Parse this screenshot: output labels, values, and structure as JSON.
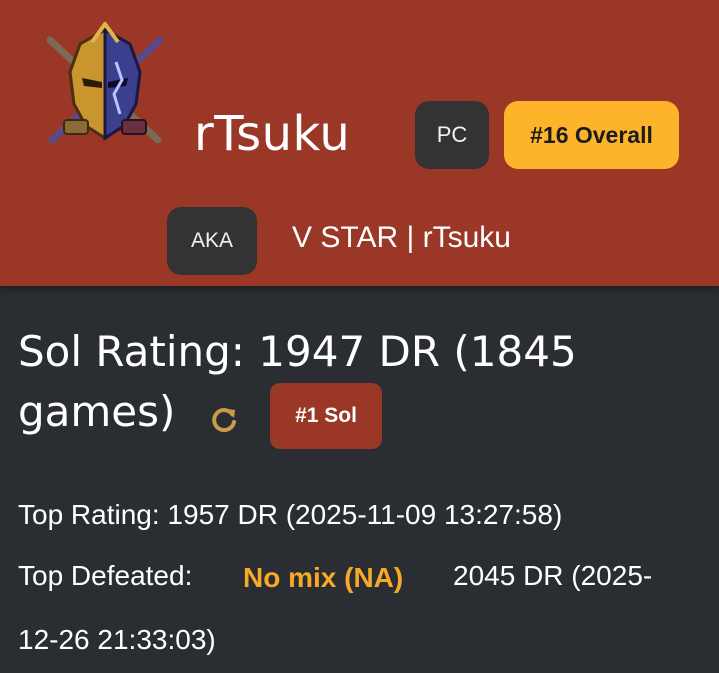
{
  "profile": {
    "avatar_icon": "armored-knight-emblem-icon",
    "name": "rTsuku",
    "platform": "PC",
    "overall_rank": "#16 Overall",
    "aka_label": "AKA",
    "aka_name": "V STAR | rTsuku"
  },
  "rating": {
    "line1": "Sol Rating: 1947 DR (1845",
    "line2": "games)",
    "refresh_icon": "refresh-icon",
    "character_rank": "#1 Sol"
  },
  "stats": {
    "top_rating": "Top Rating: 1957 DR (2025-11-09 13:27:58)",
    "top_defeated_label": "Top Defeated:",
    "top_defeated_name": "No mix (NA)",
    "top_defeated_dr_part1": "2045 DR (2025-",
    "top_defeated_dr_part2": "12-26 21:33:03)"
  },
  "colors": {
    "header_bg": "#9a3726",
    "body_bg": "#2a2d31",
    "rank_chip": "#fdb42b",
    "dark_chip": "#333333",
    "highlight_name": "#f7a928",
    "refresh_icon": "#c99b4a"
  }
}
